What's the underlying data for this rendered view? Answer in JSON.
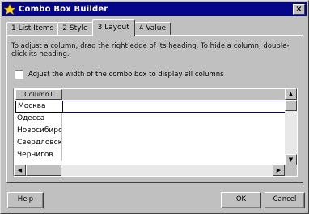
{
  "window": {
    "title": "Combo Box Builder",
    "close_glyph": "×"
  },
  "tabs": [
    {
      "label": "1 List Items",
      "active": false
    },
    {
      "label": "2 Style",
      "active": false
    },
    {
      "label": "3 Layout",
      "active": true
    },
    {
      "label": "4 Value",
      "active": false
    }
  ],
  "layout": {
    "instructions": "To adjust a column, drag the right edge of its heading. To hide a column, double-click its heading.",
    "checkbox_label": "Adjust the width of the combo box to display all columns",
    "checkbox_checked": false
  },
  "grid": {
    "column_header": "Column1",
    "rows": [
      "Москва",
      "Одесса",
      "Новосибирск",
      "Свердловск",
      "Чернигов"
    ],
    "selected_row": 0
  },
  "buttons": {
    "help": "Help",
    "ok": "OK",
    "cancel": "Cancel"
  },
  "colors": {
    "titlebar": "#06068a",
    "face": "#c0c0c0"
  }
}
